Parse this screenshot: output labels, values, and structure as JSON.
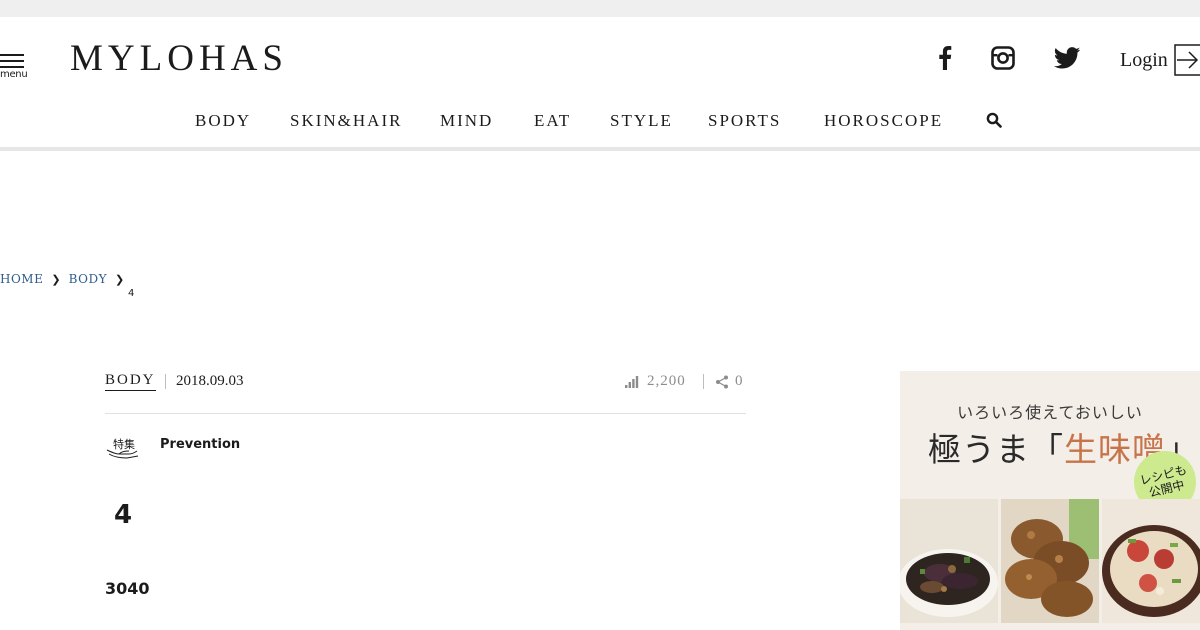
{
  "header": {
    "menu_label": "menu",
    "logo": "MYLOHAS",
    "login_label": "Login",
    "social": [
      "facebook-icon",
      "instagram-icon",
      "twitter-icon"
    ]
  },
  "nav": {
    "items": [
      "BODY",
      "SKIN&HAIR",
      "MIND",
      "EAT",
      "STYLE",
      "SPORTS",
      "HOROSCOPE"
    ],
    "search_icon": "search-icon"
  },
  "breadcrumb": {
    "home": "HOME",
    "category": "BODY",
    "current": "4"
  },
  "article": {
    "category": "BODY",
    "date": "2018.09.03",
    "views": "2,200",
    "shares": "0",
    "feature_badge": "特集",
    "feature_name": "Prevention",
    "headline": "4",
    "lead": "3040"
  },
  "ad": {
    "subtitle": "いろいろ使えておいしい",
    "title_prefix": "極うま",
    "title_open": "「",
    "title_accent": "生味噌",
    "title_close": "」",
    "badge_line1": "レシピも",
    "badge_line2": "公開中"
  },
  "colors": {
    "text": "#1b1b1b",
    "link": "#2f5d8a",
    "muted": "#8c8c8c",
    "ad_accent": "#c8744a",
    "ad_badge": "#cdea8f"
  }
}
